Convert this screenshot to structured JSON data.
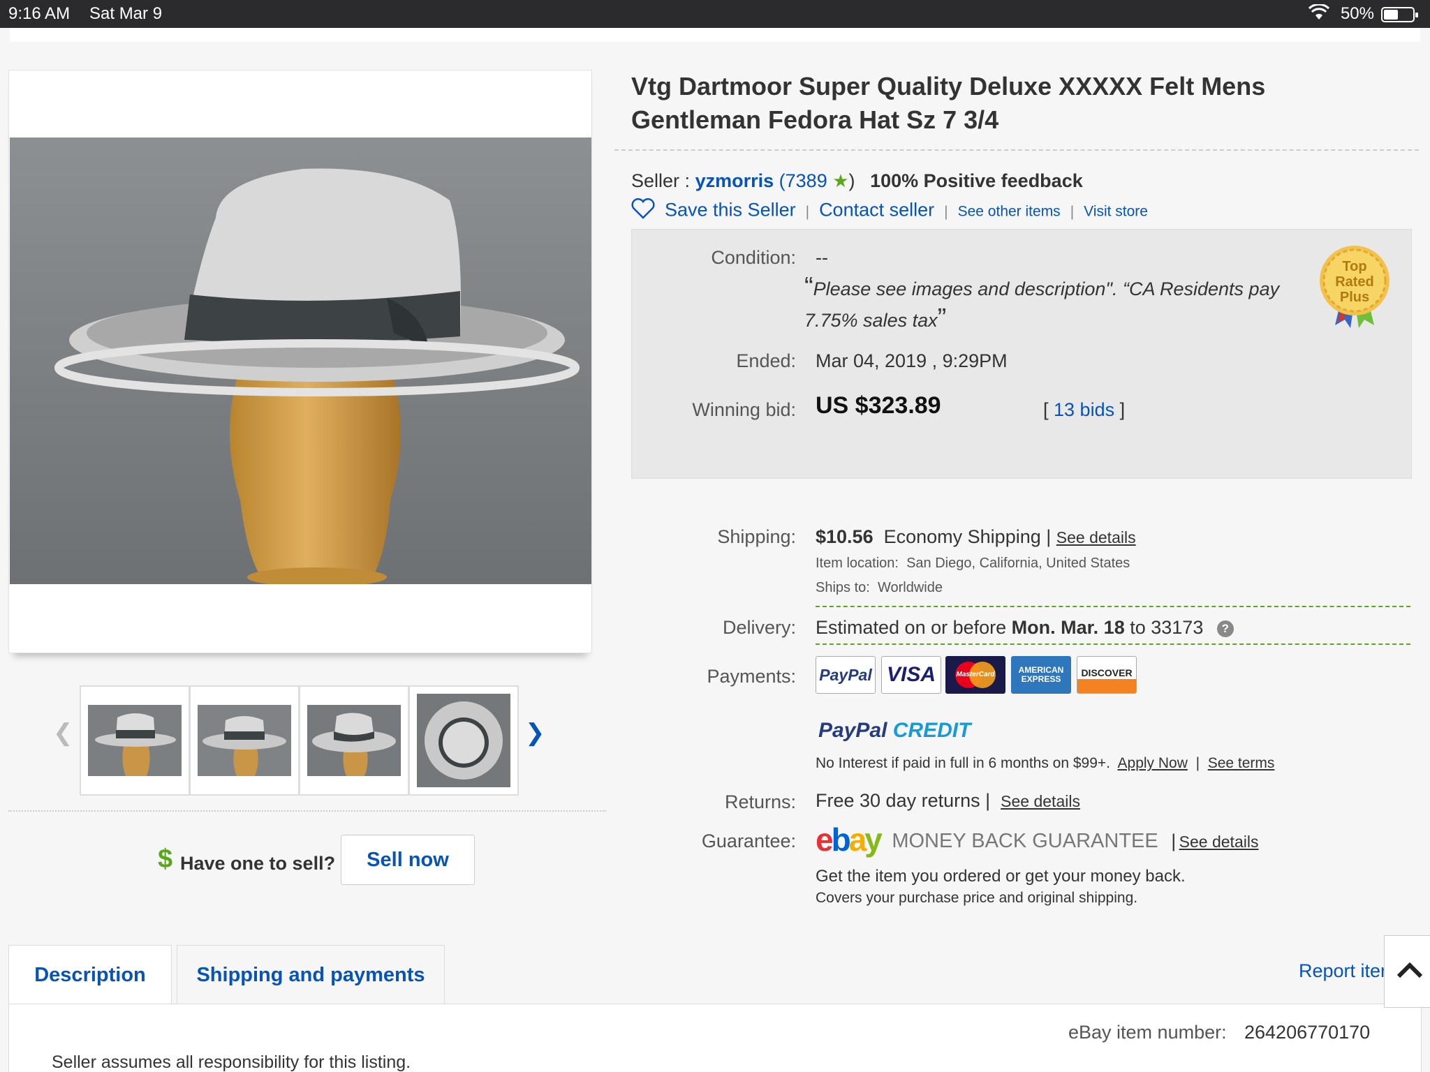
{
  "status_bar": {
    "time": "9:16 AM",
    "date": "Sat Mar 9",
    "battery": "50%"
  },
  "listing": {
    "title_line1": "Vtg Dartmoor Super Quality Deluxe XXXXX Felt Mens",
    "title_line2": "Gentleman Fedora Hat Sz 7 3/4"
  },
  "seller": {
    "label": "Seller :",
    "username": "yzmorris",
    "feedback_score": "7389",
    "positive_feedback": "100% Positive feedback",
    "save_seller": "Save this Seller",
    "contact_seller": "Contact seller",
    "see_other_items": "See other items",
    "visit_store": "Visit store"
  },
  "condition_box": {
    "condition_label": "Condition:",
    "condition_value": "--",
    "condition_note_line1": "Please see images and description\". “CA Residents pay",
    "condition_note_line2": "7.75% sales tax",
    "ended_label": "Ended:",
    "ended_value": "Mar 04, 2019 , 9:29PM",
    "winning_bid_label": "Winning bid:",
    "winning_bid_value": "US $323.89",
    "bids_count": "13 bids",
    "badge_text": [
      "Top",
      "Rated",
      "Plus"
    ]
  },
  "shipping": {
    "label": "Shipping:",
    "price": "$10.56",
    "method": "Economy Shipping",
    "see_details": "See details",
    "item_location_label": "Item location:",
    "item_location": "San Diego, California, United States",
    "ships_to_label": "Ships to:",
    "ships_to": "Worldwide"
  },
  "delivery": {
    "label": "Delivery:",
    "prefix": "Estimated on or before",
    "date": "Mon. Mar. 18",
    "suffix": "to 33173"
  },
  "payments": {
    "label": "Payments:",
    "cards": [
      "PayPal",
      "VISA",
      "MasterCard",
      "AMERICAN EXPRESS",
      "DISCOVER"
    ],
    "paypal_credit_a": "PayPal",
    "paypal_credit_b": "CREDIT",
    "credit_note": "No Interest if paid in full in 6 months on $99+.",
    "apply_now": "Apply Now",
    "see_terms": "See terms"
  },
  "returns": {
    "label": "Returns:",
    "value": "Free 30 day returns",
    "see_details": "See details"
  },
  "guarantee": {
    "label": "Guarantee:",
    "ebay_letters": [
      "e",
      "b",
      "a",
      "y"
    ],
    "title": "MONEY BACK GUARANTEE",
    "see_details": "See details",
    "line1": "Get the item you ordered or get your money back.",
    "line2": "Covers your purchase price and original shipping."
  },
  "sell_box": {
    "prompt": "Have one to sell?",
    "button": "Sell now"
  },
  "tabs": [
    "Description",
    "Shipping and payments"
  ],
  "report_item": "Report iter",
  "item_number_label": "eBay item number:",
  "item_number": "264206770170",
  "description_first_line": "Seller assumes all responsibility for this listing.",
  "colors": {
    "link_blue": "#0654ba",
    "ebay_red": "#e53238",
    "ebay_blue": "#0064d2",
    "ebay_yellow": "#f5af02",
    "ebay_green": "#86b817",
    "green_accent": "#5ba71b"
  }
}
